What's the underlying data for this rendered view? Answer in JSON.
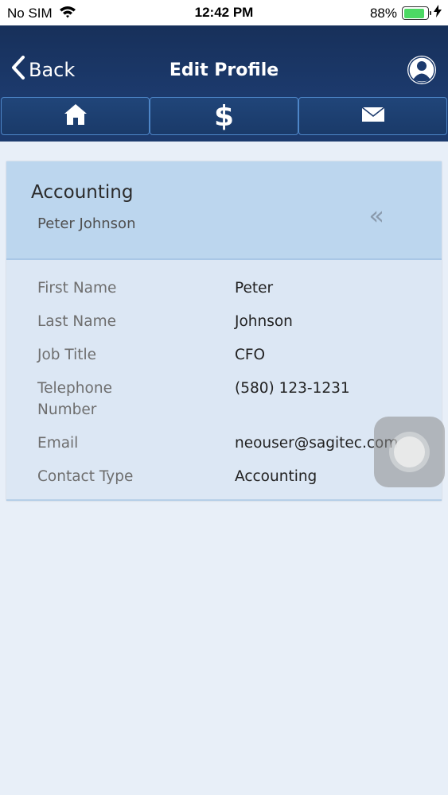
{
  "status": {
    "carrier": "No SIM",
    "time": "12:42 PM",
    "battery_percent": "88%",
    "battery_level": 0.88,
    "battery_color": "#4cd964"
  },
  "header": {
    "back_label": "Back",
    "title": "Edit Profile",
    "profile_icon": "user-circle-icon"
  },
  "tabs": [
    {
      "icon": "home-icon"
    },
    {
      "icon": "dollar-icon",
      "glyph": "$"
    },
    {
      "icon": "mail-icon"
    }
  ],
  "card": {
    "title": "Accounting",
    "subtitle": "Peter Johnson",
    "collapse_glyph": "«",
    "fields": [
      {
        "label": "First Name",
        "value": "Peter"
      },
      {
        "label": "Last Name",
        "value": "Johnson"
      },
      {
        "label": "Job Title",
        "value": "CFO"
      },
      {
        "label": "Telephone\nNumber",
        "value": "(580) 123-1231"
      },
      {
        "label": "Email",
        "value": "neouser@sagitec.com"
      },
      {
        "label": "Contact Type",
        "value": "Accounting"
      }
    ]
  },
  "colors": {
    "nav_background": "#1c3a6d",
    "card_header": "#bcd6ee",
    "card_body": "#dce7f4",
    "page_background": "#e8eff8"
  }
}
